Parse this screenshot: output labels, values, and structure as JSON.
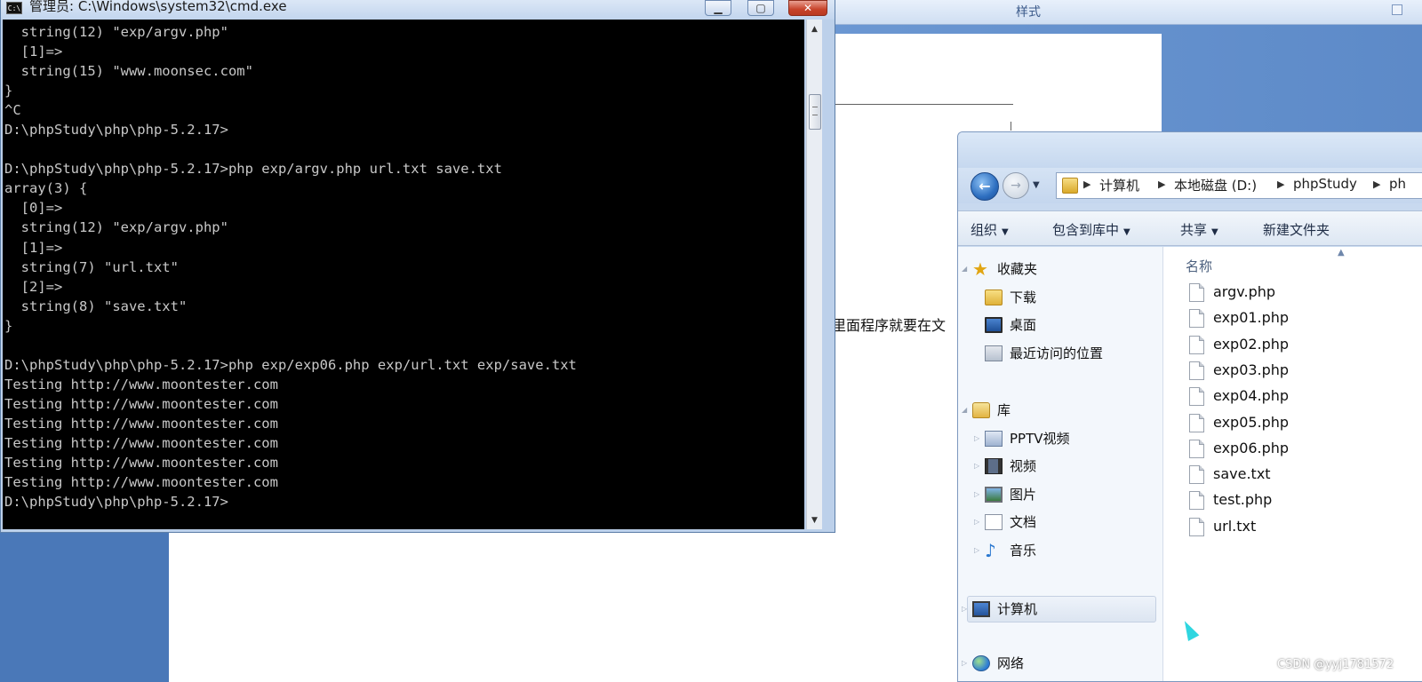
{
  "background_doc": {
    "ribbon_label": "样式",
    "body_text_fragment": "里面程序就要在文"
  },
  "cmd": {
    "title": "管理员: C:\\Windows\\system32\\cmd.exe",
    "icon_text": "C:\\",
    "lines": [
      "  string(12) \"exp/argv.php\"",
      "  [1]=>",
      "  string(15) \"www.moonsec.com\"",
      "}",
      "^C",
      "D:\\phpStudy\\php\\php-5.2.17>",
      "",
      "D:\\phpStudy\\php\\php-5.2.17>php exp/argv.php url.txt save.txt",
      "array(3) {",
      "  [0]=>",
      "  string(12) \"exp/argv.php\"",
      "  [1]=>",
      "  string(7) \"url.txt\"",
      "  [2]=>",
      "  string(8) \"save.txt\"",
      "}",
      "",
      "D:\\phpStudy\\php\\php-5.2.17>php exp/exp06.php exp/url.txt exp/save.txt",
      "Testing http://www.moontester.com",
      "Testing http://www.moontester.com",
      "Testing http://www.moontester.com",
      "Testing http://www.moontester.com",
      "Testing http://www.moontester.com",
      "Testing http://www.moontester.com",
      "D:\\phpStudy\\php\\php-5.2.17>"
    ]
  },
  "explorer": {
    "breadcrumb": [
      "计算机",
      "本地磁盘 (D:)",
      "phpStudy",
      "ph"
    ],
    "toolbar": {
      "organize": "组织",
      "include_in_library": "包含到库中",
      "share": "共享",
      "new_folder": "新建文件夹"
    },
    "nav": {
      "favorites": "收藏夹",
      "downloads": "下载",
      "desktop": "桌面",
      "recent_places": "最近访问的位置",
      "libraries": "库",
      "pptv": "PPTV视频",
      "videos": "视频",
      "pictures": "图片",
      "documents": "文档",
      "music": "音乐",
      "computer": "计算机",
      "network": "网络"
    },
    "column_name": "名称",
    "files": [
      "argv.php",
      "exp01.php",
      "exp02.php",
      "exp03.php",
      "exp04.php",
      "exp05.php",
      "exp06.php",
      "save.txt",
      "test.php",
      "url.txt"
    ]
  },
  "watermark": "CSDN @yyj1781572"
}
